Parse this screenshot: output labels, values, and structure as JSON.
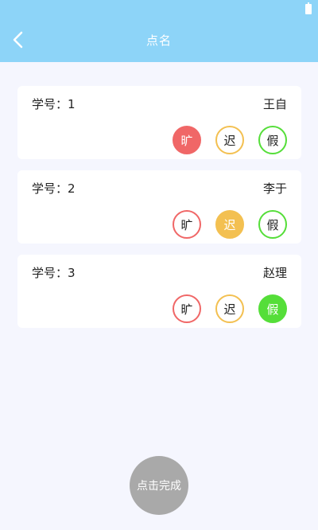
{
  "header": {
    "title": "点名"
  },
  "id_prefix": "学号：",
  "students": [
    {
      "id": "1",
      "name": "王自",
      "selected": "absent"
    },
    {
      "id": "2",
      "name": "李于",
      "selected": "late"
    },
    {
      "id": "3",
      "name": "赵理",
      "selected": "leave"
    }
  ],
  "options": {
    "absent": "旷",
    "late": "迟",
    "leave": "假"
  },
  "colors": {
    "header": "#8dd4f8",
    "absent": "#f06767",
    "late": "#f3c051",
    "leave": "#55de39",
    "finish": "#a9a9a9"
  },
  "finish_label": "点击完成",
  "icons": {
    "back": "chevron-left-icon",
    "battery": "battery-icon"
  }
}
